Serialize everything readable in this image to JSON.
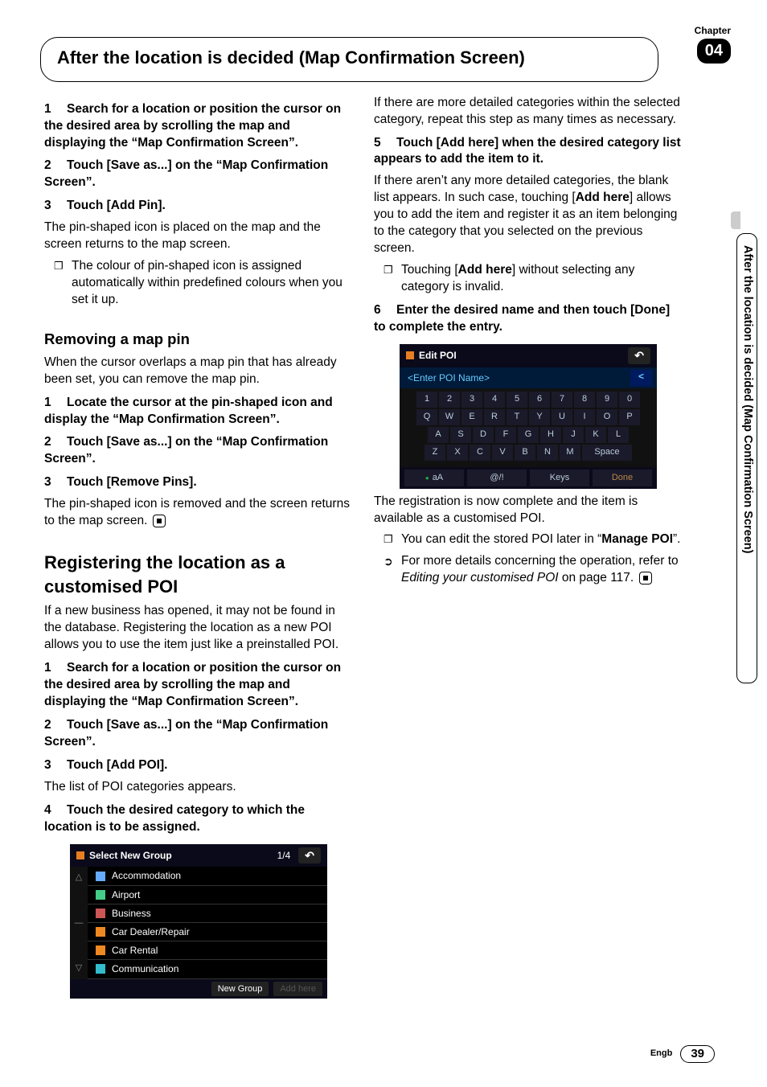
{
  "chapter": {
    "label": "Chapter",
    "number": "04"
  },
  "side_tab": "After the location is decided (Map Confirmation Screen)",
  "title": "After the location is decided (Map Confirmation Screen)",
  "left": {
    "step1": {
      "n": "1",
      "t": "Search for a location or position the cursor on the desired area by scrolling the map and displaying the “Map Confirmation Screen”."
    },
    "step2": {
      "n": "2",
      "t": "Touch [Save as...] on the “Map Confirmation Screen”."
    },
    "step3": {
      "n": "3",
      "t": "Touch [Add Pin]."
    },
    "step3_body": "The pin-shaped icon is placed on the map and the screen returns to the map screen.",
    "step3_sub": "The colour of pin-shaped icon is assigned automatically within predefined colours when you set it up.",
    "h3_remove": "Removing a map pin",
    "remove_intro": "When the cursor overlaps a map pin that has already been set, you can remove the map pin.",
    "rstep1": {
      "n": "1",
      "t": "Locate the cursor at the pin-shaped icon and display the “Map Confirmation Screen”."
    },
    "rstep2": {
      "n": "2",
      "t": "Touch [Save as...] on the “Map Confirmation Screen”."
    },
    "rstep3": {
      "n": "3",
      "t": "Touch [Remove Pins]."
    },
    "rstep3_body": "The pin-shaped icon is removed and the screen returns to the map screen.",
    "h2_reg": "Registering the location as a customised POI",
    "reg_intro": "If a new business has opened, it may not be found in the database. Registering the location as a new POI allows you to use the item just like a  preinstalled POI.",
    "gstep1": {
      "n": "1",
      "t": "Search for a location or position the cursor on the desired area by scrolling the map and displaying the “Map Confirmation Screen”."
    },
    "gstep2": {
      "n": "2",
      "t": "Touch [Save as...] on the “Map Confirmation Screen”."
    }
  },
  "right": {
    "step3": {
      "n": "3",
      "t": "Touch [Add POI]."
    },
    "step3_body": "The list of POI categories appears.",
    "step4": {
      "n": "4",
      "t": "Touch the desired category to which the location is to be assigned."
    },
    "fig1": {
      "title": "Select New Group",
      "page": "1/4",
      "back": "↶",
      "items": [
        "Accommodation",
        "Airport",
        "Business",
        "Car Dealer/Repair",
        "Car Rental",
        "Communication"
      ],
      "btn_new": "New Group",
      "btn_add": "Add here"
    },
    "after_fig1": "If there are more detailed categories within the selected category, repeat this step as many times as necessary.",
    "step5": {
      "n": "5",
      "t": "Touch [Add here] when the desired category list appears to add the item to it."
    },
    "step5_body_a": "If there aren’t any more detailed categories, the blank list appears. In such case, touching [",
    "step5_body_bold": "Add here",
    "step5_body_b": "] allows you to add the item and register it as an item belonging to the category that you selected on the previous screen.",
    "step5_sub_a": "Touching [",
    "step5_sub_bold": "Add here",
    "step5_sub_b": "] without selecting any category is invalid.",
    "step6": {
      "n": "6",
      "t": "Enter the desired name and then touch [Done] to complete the entry."
    },
    "fig2": {
      "title": "Edit POI",
      "back": "↶",
      "placeholder": "<Enter POI Name>",
      "del": "<",
      "rows": [
        [
          "1",
          "2",
          "3",
          "4",
          "5",
          "6",
          "7",
          "8",
          "9",
          "0"
        ],
        [
          "Q",
          "W",
          "E",
          "R",
          "T",
          "Y",
          "U",
          "I",
          "O",
          "P"
        ],
        [
          "A",
          "S",
          "D",
          "F",
          "G",
          "H",
          "J",
          "K",
          "L"
        ],
        [
          "Z",
          "X",
          "C",
          "V",
          "B",
          "N",
          "M"
        ]
      ],
      "space": "Space",
      "ftr": [
        "aA",
        "@/!",
        "Keys",
        "Done"
      ]
    },
    "after_fig2": "The registration is now complete and the item is available as a customised POI.",
    "sub_manage_a": "You can edit the stored POI later in “",
    "sub_manage_bold": "Manage POI",
    "sub_manage_b": "”.",
    "ref_a": "For more details concerning the operation, refer to ",
    "ref_italic": "Editing your customised POI",
    "ref_b": " on page 117."
  },
  "footer": {
    "lang": "Engb",
    "page": "39"
  }
}
